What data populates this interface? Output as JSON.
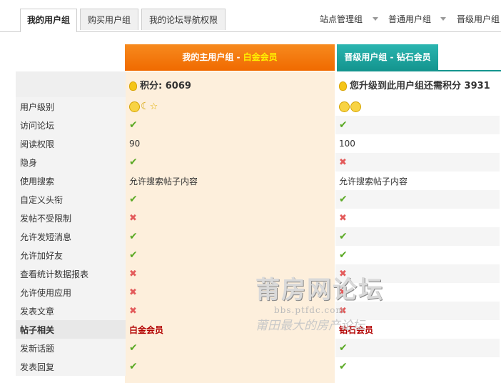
{
  "tabs": [
    "我的用户组",
    "购买用户组",
    "我的论坛导航权限"
  ],
  "right_tabs": [
    "站点管理组",
    "普通用户组",
    "晋级用户组"
  ],
  "columns": {
    "current_prefix": "我的主用户组 - ",
    "current_name": "白金会员",
    "next": "晋级用户组 - 钻石会员"
  },
  "points": {
    "current": "积分: 6069",
    "next": "您升级到此用户组还需积分 3931"
  },
  "rows": [
    {
      "label": "用户级别",
      "c1": "icons",
      "c2": "icons"
    },
    {
      "label": "访问论坛",
      "c1": "check",
      "c2": "check"
    },
    {
      "label": "阅读权限",
      "c1": "90",
      "c2": "100"
    },
    {
      "label": "隐身",
      "c1": "check",
      "c2": "cross"
    },
    {
      "label": "使用搜索",
      "c1": "允许搜索帖子内容",
      "c2": "允许搜索帖子内容"
    },
    {
      "label": "自定义头衔",
      "c1": "check",
      "c2": "check"
    },
    {
      "label": "发帖不受限制",
      "c1": "cross",
      "c2": "cross"
    },
    {
      "label": "允许发短消息",
      "c1": "check",
      "c2": "check"
    },
    {
      "label": "允许加好友",
      "c1": "check",
      "c2": "check"
    },
    {
      "label": "查看统计数据报表",
      "c1": "cross",
      "c2": "cross"
    },
    {
      "label": "允许使用应用",
      "c1": "cross",
      "c2": "cross"
    },
    {
      "label": "发表文章",
      "c1": "cross",
      "c2": "cross"
    },
    {
      "label": "帖子相关",
      "c1": "白金会员",
      "c2": "钻石会员"
    },
    {
      "label": "发新话题",
      "c1": "check",
      "c2": "check"
    },
    {
      "label": "发表回复",
      "c1": "check",
      "c2": "check"
    }
  ],
  "watermark": {
    "line1": "莆房网论坛",
    "line2": "bbs.ptfdc.com",
    "line3": "莆田最大的房产论坛"
  }
}
